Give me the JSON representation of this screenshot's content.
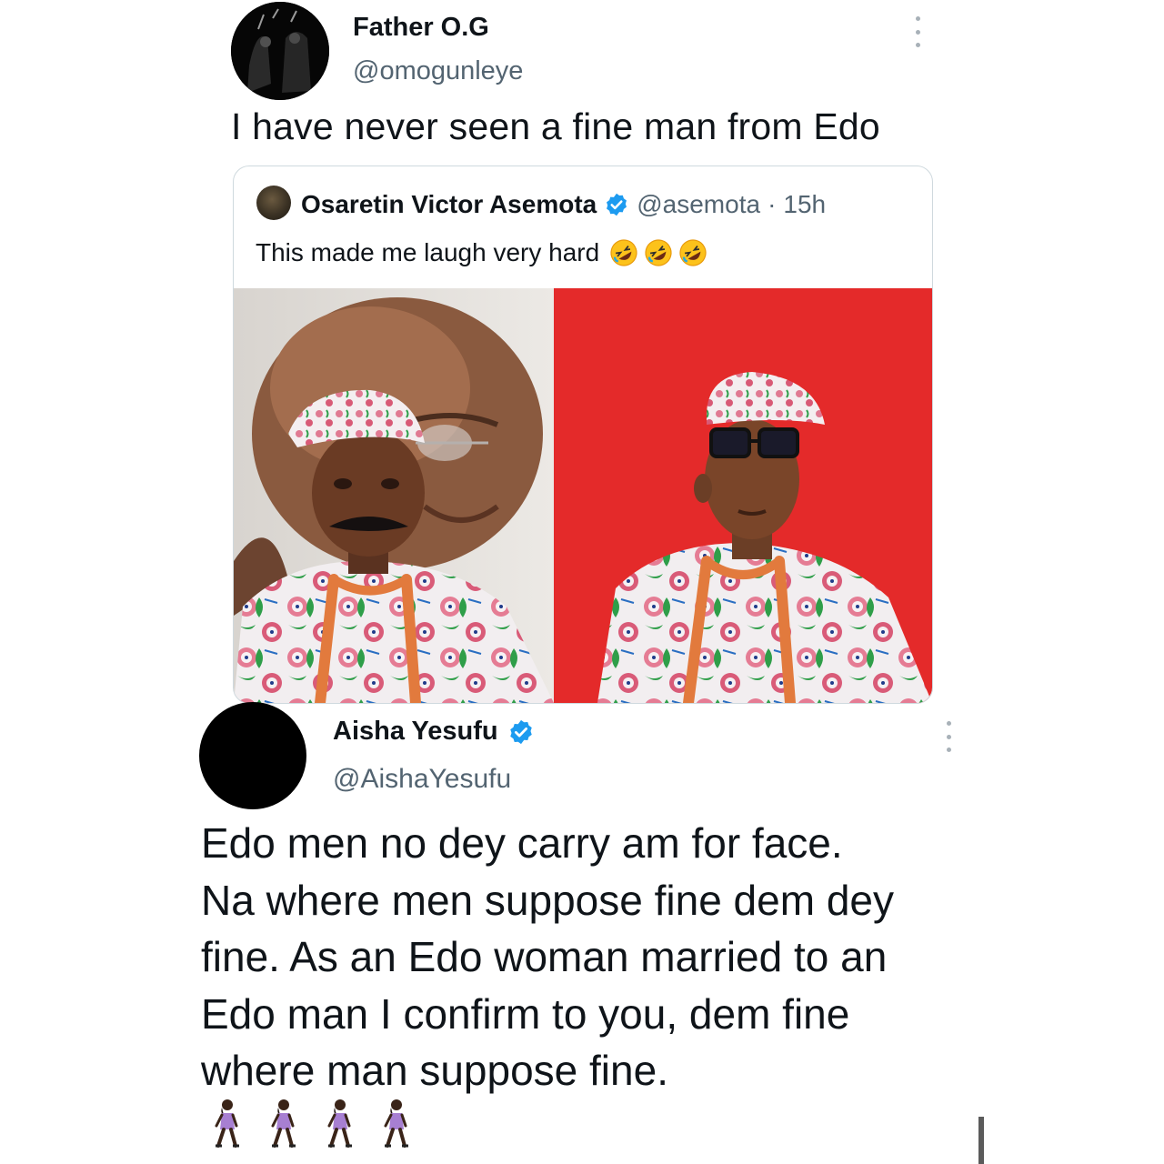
{
  "top_tweet": {
    "name": "Father O.G",
    "handle": "@omogunleye",
    "text": "I have never seen a fine man from Edo",
    "more_icon": "more-vertical-icon"
  },
  "quoted_tweet": {
    "name": "Osaretin Victor Asemota",
    "handle": "@asemota",
    "separator": "·",
    "time": "15h",
    "text": "This made me laugh very hard",
    "emoji_icons": [
      "rolling-on-floor-laughing-icon",
      "rolling-on-floor-laughing-icon",
      "rolling-on-floor-laughing-icon"
    ],
    "image_icon": "photo-two-men-in-traditional-attire"
  },
  "reply_tweet": {
    "name": "Aisha Yesufu",
    "handle": "@AishaYesufu",
    "text_lines": [
      "Edo men no dey carry am for face.",
      "Na where men suppose fine dem dey",
      "fine. As an Edo woman married to an",
      "Edo man I confirm to you, dem fine",
      "where man suppose fine."
    ],
    "emoji_icons": [
      "woman-walking-icon",
      "woman-walking-icon",
      "woman-walking-icon",
      "woman-walking-icon"
    ],
    "more_icon": "more-vertical-icon"
  },
  "colors": {
    "verified_blue": "#1d9bf0",
    "secondary_text": "#536471",
    "red_background": "#e42a2a"
  }
}
